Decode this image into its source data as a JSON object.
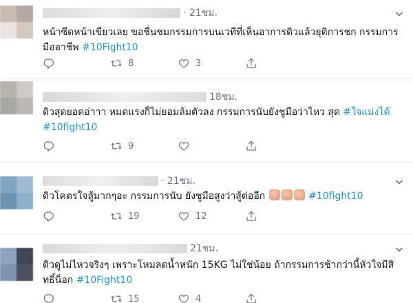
{
  "tweets": [
    {
      "time": "· 21ชม.",
      "text": "หน้าซีดหน้าเขียวเลย ขอชื่นชมกรรมการบนเวทีที่เห็นอาการดิวแล้วยุติการชก กรรมการมืออาชีพ ",
      "hashtag": "#10Fight10",
      "replies": "",
      "retweets": "8",
      "likes": "3",
      "avatar_colors": [
        "#c8bdb4",
        "#b5aaa3",
        "#eae3df",
        "#d3c7c0"
      ]
    },
    {
      "time": "18ชม.",
      "text": "ดิวสุดยอดอ่าาา หมดแรงก็ไม่ยอมล้มตัวลง กรรมการนับยังชูมือว่าไหว สุด ",
      "hashtag1": "#ใจแม่งได้",
      "hashtag": "#10fight10",
      "replies": "",
      "retweets": "9",
      "likes": "",
      "avatar_colors": [
        "#b8b3ab",
        "#cfcac4",
        "#a9a7a2",
        "#bdb8b1"
      ]
    },
    {
      "time": "· 21ชม.",
      "text": "ดิวโคตรใจสู้มากๆอะ กรรมการนับ ยังชูมือสูงว่าสู้ต่ออีก ",
      "hashtag": "#10fight10",
      "replies": "",
      "retweets": "19",
      "likes": "12",
      "avatar_colors": [
        "#7fa6c4",
        "#9bbad3",
        "#6d93b3",
        "#8eb0ca"
      ]
    },
    {
      "time": "21ชม.",
      "text": "ดิวดูไม่ไหวจริงๆ เพราะโหมลดน้ำหนัก 15KG ไม่ใช่น้อย ถ้ากรรมการช้ากว่านี้หัวใจมีสิทธิ์น็อก ",
      "hashtag": "#10Fight10",
      "replies": "",
      "retweets": "15",
      "likes": "4",
      "avatar_colors": [
        "#8fa3bd",
        "#3f4654",
        "#7d93ae",
        "#4a5262"
      ]
    }
  ],
  "icons": {
    "reply": "reply-icon",
    "retweet": "retweet-icon",
    "like": "heart-icon",
    "share": "share-icon",
    "menu": "chevron-down-icon"
  },
  "colors": {
    "hashtag": "#1b95e0",
    "meta": "#657786",
    "divider": "#e6ecf0"
  }
}
